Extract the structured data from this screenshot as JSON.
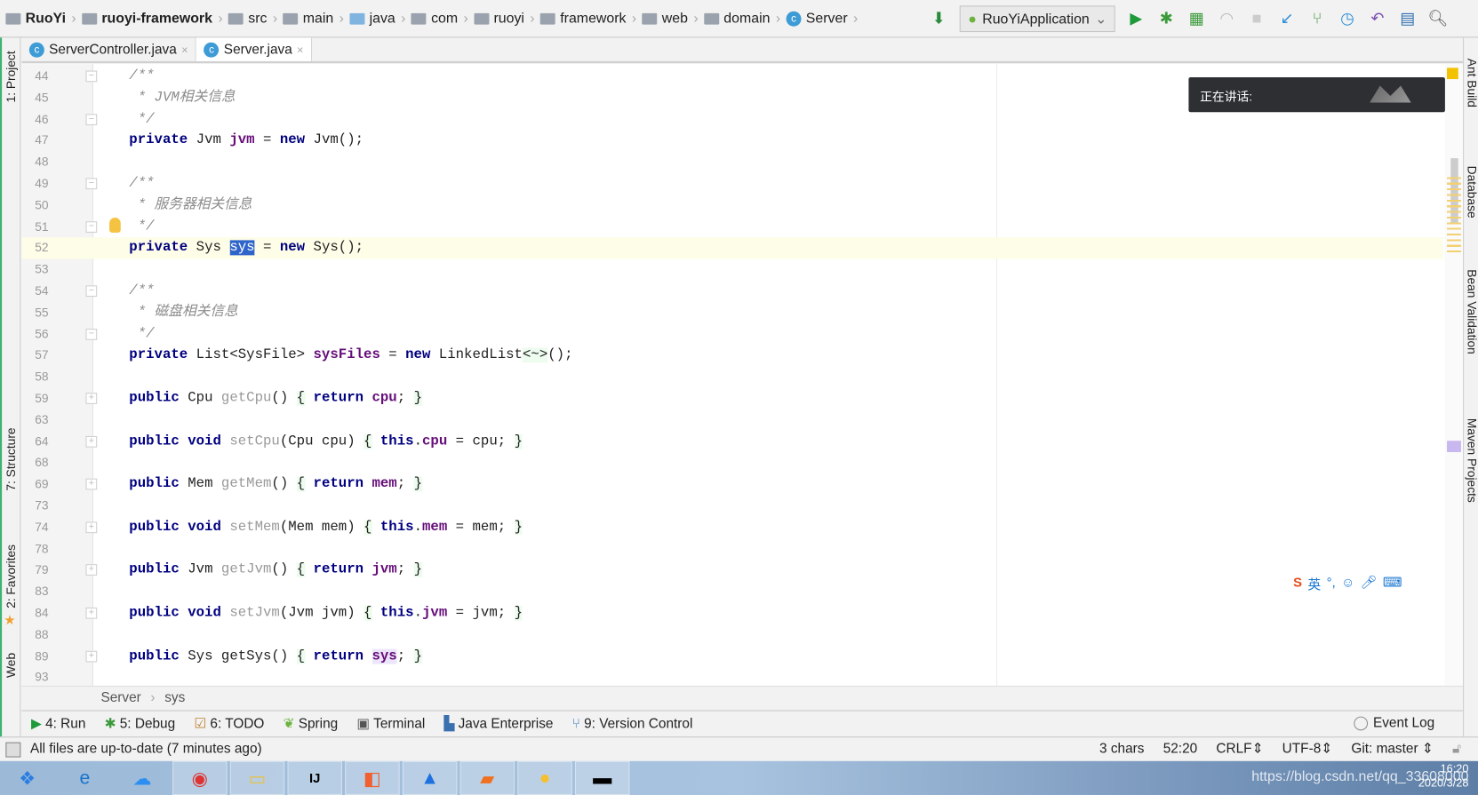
{
  "breadcrumbs": [
    {
      "label": "RuoYi",
      "bold": true,
      "icon": "module-folder-icon"
    },
    {
      "label": "ruoyi-framework",
      "bold": true,
      "icon": "module-folder-icon"
    },
    {
      "label": "src",
      "icon": "folder-icon"
    },
    {
      "label": "main",
      "icon": "folder-icon"
    },
    {
      "label": "java",
      "icon": "source-folder-icon"
    },
    {
      "label": "com",
      "icon": "package-icon"
    },
    {
      "label": "ruoyi",
      "icon": "package-icon"
    },
    {
      "label": "framework",
      "icon": "package-icon"
    },
    {
      "label": "web",
      "icon": "package-icon"
    },
    {
      "label": "domain",
      "icon": "package-icon"
    },
    {
      "label": "Server",
      "icon": "class-icon"
    }
  ],
  "toolbar": {
    "run_config": "RuoYiApplication"
  },
  "tabs": [
    {
      "label": "ServerController.java",
      "active": false
    },
    {
      "label": "Server.java",
      "active": true
    }
  ],
  "left_tools": {
    "project": "1: Project",
    "structure": "7: Structure",
    "favorites": "2: Favorites",
    "web": "Web"
  },
  "right_tools": {
    "ant": "Ant Build",
    "database": "Database",
    "bean": "Bean Validation",
    "maven": "Maven Projects"
  },
  "popup": {
    "text": "正在讲话:"
  },
  "lines": [
    {
      "n": "44",
      "fold": "-",
      "t": [
        [
          "cm",
          "/**"
        ]
      ]
    },
    {
      "n": "45",
      "t": [
        [
          "cm",
          " * JVM相关信息"
        ]
      ]
    },
    {
      "n": "46",
      "fold": "-",
      "t": [
        [
          "cm",
          " */"
        ]
      ]
    },
    {
      "n": "47",
      "t": [
        [
          "kw",
          "private"
        ],
        [
          "",
          " Jvm "
        ],
        [
          "fld",
          "jvm"
        ],
        [
          "",
          " = "
        ],
        [
          "kw",
          "new"
        ],
        [
          "",
          " Jvm();"
        ]
      ]
    },
    {
      "n": "48",
      "t": []
    },
    {
      "n": "49",
      "fold": "-",
      "t": [
        [
          "cm",
          "/**"
        ]
      ]
    },
    {
      "n": "50",
      "t": [
        [
          "cm",
          " * 服务器相关信息"
        ]
      ]
    },
    {
      "n": "51",
      "fold": "-",
      "t": [
        [
          "cm",
          " */"
        ]
      ]
    },
    {
      "n": "52",
      "current": true,
      "t": [
        [
          "kw",
          "private"
        ],
        [
          "",
          " Sys "
        ],
        [
          "sel",
          "sys"
        ],
        [
          "",
          " = "
        ],
        [
          "kw",
          "new"
        ],
        [
          "",
          " Sys();"
        ]
      ]
    },
    {
      "n": "53",
      "t": []
    },
    {
      "n": "54",
      "fold": "-",
      "t": [
        [
          "cm",
          "/**"
        ]
      ]
    },
    {
      "n": "55",
      "t": [
        [
          "cm",
          " * 磁盘相关信息"
        ]
      ]
    },
    {
      "n": "56",
      "fold": "-",
      "t": [
        [
          "cm",
          " */"
        ]
      ]
    },
    {
      "n": "57",
      "t": [
        [
          "kw",
          "private"
        ],
        [
          "",
          " List<SysFile> "
        ],
        [
          "fld",
          "sysFiles"
        ],
        [
          "",
          " = "
        ],
        [
          "kw",
          "new"
        ],
        [
          "",
          " LinkedList"
        ],
        [
          "br",
          "<~>"
        ],
        [
          "",
          "();"
        ]
      ]
    },
    {
      "n": "58",
      "t": []
    },
    {
      "n": "59",
      "fold": "+",
      "t": [
        [
          "kw",
          "public"
        ],
        [
          "",
          " Cpu "
        ],
        [
          "dim",
          "getCpu"
        ],
        [
          "",
          "() "
        ],
        [
          "br",
          "{"
        ],
        [
          " ",
          " "
        ],
        [
          "kw",
          "return"
        ],
        [
          "",
          " "
        ],
        [
          "fld",
          "cpu"
        ],
        [
          "",
          ";"
        ],
        [
          " ",
          " "
        ],
        [
          "br",
          "}"
        ]
      ]
    },
    {
      "n": "63",
      "t": []
    },
    {
      "n": "64",
      "fold": "+",
      "t": [
        [
          "kw",
          "public void"
        ],
        [
          "",
          " "
        ],
        [
          "dim",
          "setCpu"
        ],
        [
          "",
          "(Cpu cpu) "
        ],
        [
          "br",
          "{"
        ],
        [
          "",
          " "
        ],
        [
          "kw",
          "this"
        ],
        [
          "",
          "."
        ],
        [
          "fld",
          "cpu"
        ],
        [
          "",
          " = cpu; "
        ],
        [
          "br",
          "}"
        ]
      ]
    },
    {
      "n": "68",
      "t": []
    },
    {
      "n": "69",
      "fold": "+",
      "t": [
        [
          "kw",
          "public"
        ],
        [
          "",
          " Mem "
        ],
        [
          "dim",
          "getMem"
        ],
        [
          "",
          "() "
        ],
        [
          "br",
          "{"
        ],
        [
          "",
          " "
        ],
        [
          "kw",
          "return"
        ],
        [
          "",
          " "
        ],
        [
          "fld",
          "mem"
        ],
        [
          "",
          "; "
        ],
        [
          "br",
          "}"
        ]
      ]
    },
    {
      "n": "73",
      "t": []
    },
    {
      "n": "74",
      "fold": "+",
      "t": [
        [
          "kw",
          "public void"
        ],
        [
          "",
          " "
        ],
        [
          "dim",
          "setMem"
        ],
        [
          "",
          "(Mem mem) "
        ],
        [
          "br",
          "{"
        ],
        [
          "",
          " "
        ],
        [
          "kw",
          "this"
        ],
        [
          "",
          "."
        ],
        [
          "fld",
          "mem"
        ],
        [
          "",
          " = mem; "
        ],
        [
          "br",
          "}"
        ]
      ]
    },
    {
      "n": "78",
      "t": []
    },
    {
      "n": "79",
      "fold": "+",
      "t": [
        [
          "kw",
          "public"
        ],
        [
          "",
          " Jvm "
        ],
        [
          "dim",
          "getJvm"
        ],
        [
          "",
          "() "
        ],
        [
          "br",
          "{"
        ],
        [
          "",
          " "
        ],
        [
          "kw",
          "return"
        ],
        [
          "",
          " "
        ],
        [
          "fld",
          "jvm"
        ],
        [
          "",
          "; "
        ],
        [
          "br",
          "}"
        ]
      ]
    },
    {
      "n": "83",
      "t": []
    },
    {
      "n": "84",
      "fold": "+",
      "t": [
        [
          "kw",
          "public void"
        ],
        [
          "",
          " "
        ],
        [
          "dim",
          "setJvm"
        ],
        [
          "",
          "(Jvm jvm) "
        ],
        [
          "br",
          "{"
        ],
        [
          "",
          " "
        ],
        [
          "kw",
          "this"
        ],
        [
          "",
          "."
        ],
        [
          "fld",
          "jvm"
        ],
        [
          "",
          " = jvm; "
        ],
        [
          "br",
          "}"
        ]
      ]
    },
    {
      "n": "88",
      "t": []
    },
    {
      "n": "89",
      "fold": "+",
      "t": [
        [
          "kw",
          "public"
        ],
        [
          "",
          " Sys getSys() "
        ],
        [
          "br",
          "{"
        ],
        [
          "",
          " "
        ],
        [
          "kw",
          "return"
        ],
        [
          "",
          " "
        ],
        [
          "fldsel",
          "sys"
        ],
        [
          "",
          "; "
        ],
        [
          "br",
          "}"
        ]
      ]
    },
    {
      "n": "93",
      "t": []
    }
  ],
  "editor_breadcrumb": {
    "class": "Server",
    "member": "sys"
  },
  "tool_windows": [
    {
      "label": "4: Run",
      "icon": "run-icon"
    },
    {
      "label": "5: Debug",
      "icon": "debug-icon"
    },
    {
      "label": "6: TODO",
      "icon": "todo-icon"
    },
    {
      "label": "Spring",
      "icon": "spring-icon"
    },
    {
      "label": "Terminal",
      "icon": "terminal-icon"
    },
    {
      "label": "Java Enterprise",
      "icon": "java-enterprise-icon"
    },
    {
      "label": "9: Version Control",
      "icon": "version-control-icon"
    }
  ],
  "event_log": "Event Log",
  "status": {
    "message": "All files are up-to-date (7 minutes ago)",
    "chars": "3 chars",
    "position": "52:20",
    "line_sep": "CRLF",
    "encoding": "UTF-8",
    "vcs": "Git: master"
  },
  "taskbar": {
    "time": "16:20",
    "date": "2020/3/28",
    "watermark": "https://blog.csdn.net/qq_33608000"
  }
}
